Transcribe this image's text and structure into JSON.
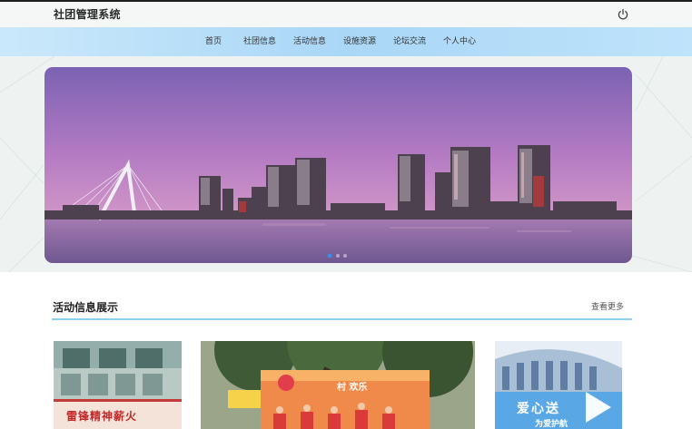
{
  "app": {
    "title": "社团管理系统"
  },
  "nav": {
    "items": [
      {
        "label": "首页"
      },
      {
        "label": "社团信息"
      },
      {
        "label": "活动信息"
      },
      {
        "label": "设施资源"
      },
      {
        "label": "论坛交流"
      },
      {
        "label": "个人中心"
      }
    ]
  },
  "carousel": {
    "slide_count": 3,
    "active_slide": 1
  },
  "section": {
    "title": "活动信息展示",
    "more_label": "查看更多"
  },
  "cards": [
    {
      "banner_text": "雷锋精神薪火"
    },
    {
      "sign_text": "村 欢乐"
    },
    {
      "banner_text": "爱心送",
      "sub_text": "为爱护航"
    }
  ],
  "colors": {
    "nav_gradient": "#a9d7f6",
    "accent_line": "#8ecdf0",
    "active_dot": "#3a8ee6"
  },
  "icons": {
    "power": "power-icon",
    "play": "play-icon"
  }
}
